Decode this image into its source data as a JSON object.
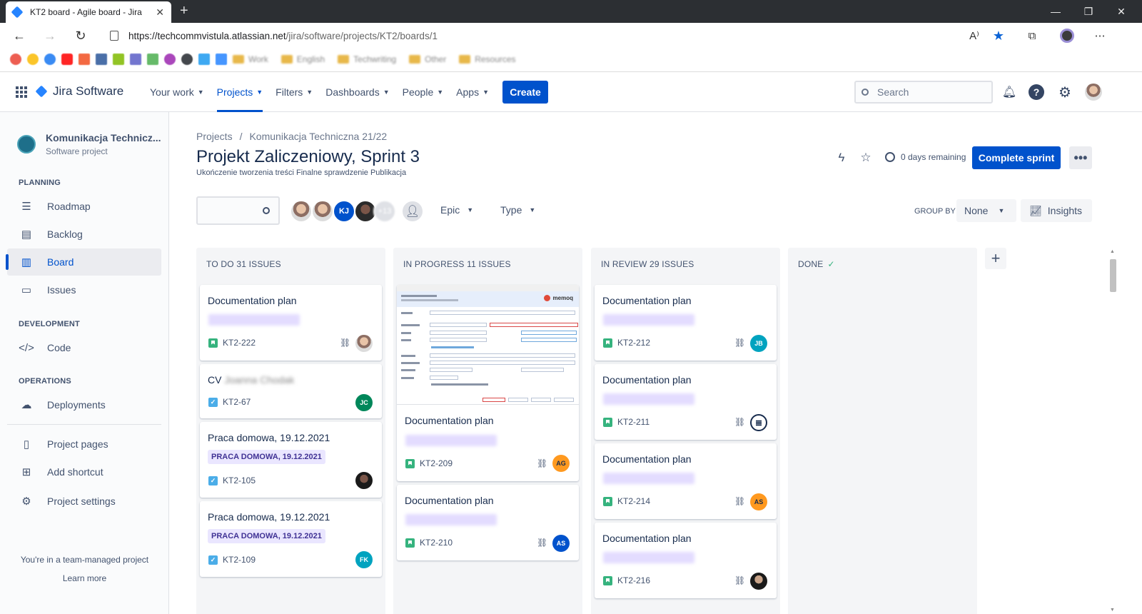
{
  "browser": {
    "tab_title": "KT2 board - Agile board - Jira",
    "tab_close": "✕",
    "new_tab": "+",
    "url_host": "https://techcommvistula.atlassian.net",
    "url_path": "/jira/software/projects/KT2/boards/1",
    "bookmark_folders": [
      "Work",
      "English",
      "Techwriting",
      "Other",
      "Resources"
    ]
  },
  "header": {
    "logo": "Jira Software",
    "nav": [
      {
        "label": "Your work"
      },
      {
        "label": "Projects",
        "active": true
      },
      {
        "label": "Filters"
      },
      {
        "label": "Dashboards"
      },
      {
        "label": "People"
      },
      {
        "label": "Apps"
      }
    ],
    "create_label": "Create",
    "search_placeholder": "Search"
  },
  "sidebar": {
    "project_name": "Komunikacja Technicz...",
    "project_type": "Software project",
    "sections": {
      "planning": "PLANNING",
      "development": "DEVELOPMENT",
      "operations": "OPERATIONS"
    },
    "items": {
      "roadmap": "Roadmap",
      "backlog": "Backlog",
      "board": "Board",
      "issues": "Issues",
      "code": "Code",
      "deployments": "Deployments",
      "project_pages": "Project pages",
      "add_shortcut": "Add shortcut",
      "project_settings": "Project settings"
    },
    "team_note": "You're in a team-managed project",
    "learn_more": "Learn more"
  },
  "main": {
    "breadcrumb": [
      "Projects",
      "Komunikacja Techniczna 21/22"
    ],
    "title": "Projekt Zaliczeniowy, Sprint 3",
    "goal": "Ukończenie tworzenia treści Finalne sprawdzenie Publikacja",
    "remaining": "0 days remaining",
    "complete_sprint": "Complete sprint",
    "more": "•••",
    "filters": {
      "avatar_initials": "KJ",
      "more_count": "+13",
      "epic": "Epic",
      "type": "Type",
      "group_by_label": "GROUP BY",
      "group_by_value": "None",
      "insights": "Insights"
    }
  },
  "columns": [
    {
      "title": "TO DO 31 ISSUES",
      "cards": [
        {
          "title": "Documentation plan",
          "key": "KT2-222",
          "type": "story",
          "blurred_label": true,
          "assignee": "photo"
        },
        {
          "title": "CV",
          "blurred_suffix": "Joanna Chodak",
          "key": "KT2-67",
          "type": "task",
          "assignee": "JC",
          "assignee_color": "#00875a"
        },
        {
          "title": "Praca domowa, 19.12.2021",
          "label": "PRACA DOMOWA, 19.12.2021",
          "key": "KT2-105",
          "type": "task",
          "assignee": "photo-dark"
        },
        {
          "title": "Praca domowa, 19.12.2021",
          "label": "PRACA DOMOWA, 19.12.2021",
          "key": "KT2-109",
          "type": "task",
          "assignee": "FK",
          "assignee_color": "#00a3bf"
        }
      ]
    },
    {
      "title": "IN PROGRESS 11 ISSUES",
      "cards": [
        {
          "title": "Documentation plan",
          "key": "KT2-209",
          "type": "story",
          "blurred_label": true,
          "assignee": "AG",
          "assignee_color": "#ff991f",
          "screenshot_logo": "memoq"
        },
        {
          "title": "Documentation plan",
          "key": "KT2-210",
          "type": "story",
          "blurred_label": true,
          "assignee": "AS",
          "assignee_color": "#0052cc"
        }
      ]
    },
    {
      "title": "IN REVIEW 29 ISSUES",
      "cards": [
        {
          "title": "Documentation plan",
          "key": "KT2-212",
          "type": "story",
          "blurred_label": true,
          "assignee": "JB",
          "assignee_color": "#00a3bf"
        },
        {
          "title": "Documentation plan",
          "key": "KT2-211",
          "type": "story",
          "blurred_label": true,
          "assignee": "doc-icon"
        },
        {
          "title": "Documentation plan",
          "key": "KT2-214",
          "type": "story",
          "blurred_label": true,
          "assignee": "AS",
          "assignee_color": "#ff991f"
        },
        {
          "title": "Documentation plan",
          "key": "KT2-216",
          "type": "story",
          "blurred_label": true,
          "assignee": "photo-dark"
        }
      ]
    },
    {
      "title": "DONE",
      "check": "✓",
      "cards": []
    }
  ]
}
